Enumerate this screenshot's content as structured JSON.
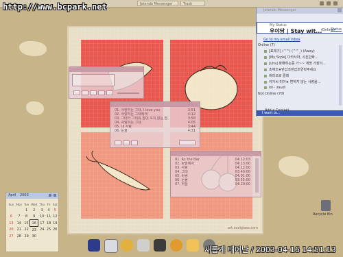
{
  "watermark": "http://www.bcpark.net",
  "taskbar": {
    "buttons": [
      "Jetendo Messenger",
      "Trash"
    ]
  },
  "wallpaper": {
    "credit": "art.coolglass.com"
  },
  "media_player": {
    "title": ""
  },
  "playlist": {
    "rows": [
      {
        "title": "01. 사랑하는 그대, I love you",
        "time": "3:51"
      },
      {
        "title": "02. 사랑하는 그대에게",
        "time": "4:12"
      },
      {
        "title": "03. 그대가 그리워 잠이 오지 않는 밤",
        "time": "3:58"
      },
      {
        "title": "04. 사랑하는 그대",
        "time": "4:05"
      },
      {
        "title": "05. 내 사랑",
        "time": "3:44"
      },
      {
        "title": "06. 눈물",
        "time": "4:31"
      },
      {
        "title": "07. 그대",
        "time": "3:29"
      }
    ]
  },
  "playlist2": {
    "rows": [
      {
        "title": "01. Rc the Bar",
        "time": "04:12:03"
      },
      {
        "title": "02. 꽃밭에서",
        "time": "04:13:00"
      },
      {
        "title": "03. 사랑",
        "time": "04:12:00"
      },
      {
        "title": "04. 그대",
        "time": "03:40:00"
      },
      {
        "title": "05. 바람",
        "time": "04:01:00"
      },
      {
        "title": "06. 눈물",
        "time": "03:55:00"
      },
      {
        "title": "07. 하늘",
        "time": "04:20:00"
      }
    ]
  },
  "messenger": {
    "window_title": "Jetendo Messenger",
    "nick_prefix": "My Status",
    "name": "우야당 | Stay wit...",
    "online": "(Online)",
    "status_link": "Status",
    "inbox": "Go to my email inbox",
    "online_group": "Online (7)",
    "contacts": [
      "[표제기] (^^) (^^_) (Away)",
      "[My Style] 다카사마, 사진만화...",
      "[uhs] 화해하는중 가~~ 게명 가장이...",
      "초애조★반갑조반갑조연락주세요",
      "바라오로 클래",
      "아가씨 미야★ 변하지 않는 사랑을...",
      "lol - zaudi"
    ],
    "offline_group": "Not Online (70)",
    "i_want": "I want to...",
    "add_contact": "Add a Contact"
  },
  "calendar": {
    "month": "April",
    "year": "2003",
    "dow": [
      "Sun",
      "Mon",
      "Tue",
      "Wed",
      "Thu",
      "Fri",
      "Sat"
    ],
    "weeks": [
      [
        "",
        "",
        "1",
        "2",
        "3",
        "4",
        "5"
      ],
      [
        "6",
        "7",
        "8",
        "9",
        "10",
        "11",
        "12"
      ],
      [
        "13",
        "14",
        "15",
        "16",
        "17",
        "18",
        "19"
      ],
      [
        "20",
        "21",
        "22",
        "23",
        "24",
        "25",
        "26"
      ],
      [
        "27",
        "28",
        "29",
        "30",
        "",
        "",
        ""
      ]
    ],
    "today": "16"
  },
  "clock": {
    "text": "새롭게 태어난 / 2003-04-16 14:51:13"
  },
  "desktop_icon": {
    "label": "Recycle Bin"
  }
}
